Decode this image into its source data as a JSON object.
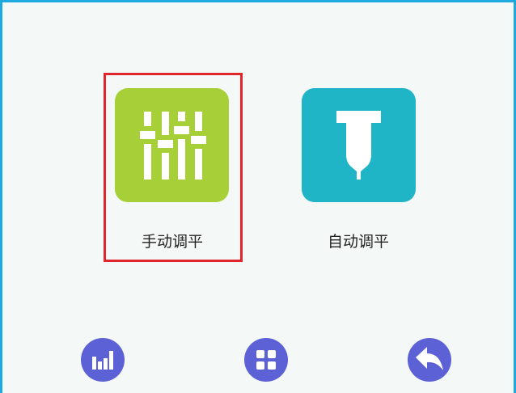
{
  "screen": {
    "border_color": "#1da9de",
    "background_color": "#f4f9f7"
  },
  "tiles": {
    "manual": {
      "label": "手动调平",
      "icon": "sliders-icon",
      "color": "#a6cf38",
      "selected": true,
      "selection_color": "#e0262b"
    },
    "auto": {
      "label": "自动调平",
      "icon": "probe-pin-icon",
      "color": "#20b4c7",
      "selected": false
    }
  },
  "nav": {
    "color": "#5c62d6",
    "items": [
      {
        "icon": "bar-chart-icon"
      },
      {
        "icon": "grid-menu-icon"
      },
      {
        "icon": "back-arrow-icon"
      }
    ]
  }
}
